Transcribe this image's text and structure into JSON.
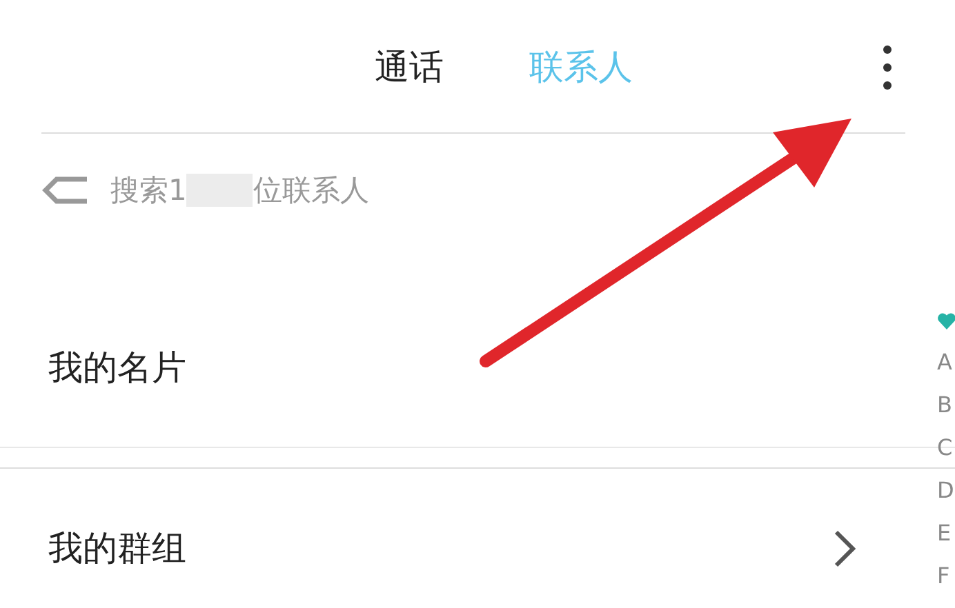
{
  "tabs": [
    {
      "label": "通话",
      "selected": false
    },
    {
      "label": "联系人",
      "selected": true
    }
  ],
  "search": {
    "placeholder_start": "搜索1",
    "placeholder_end": "位联系人"
  },
  "rows": [
    {
      "label": "我的名片",
      "chevron": false
    },
    {
      "label": "我的群组",
      "chevron": true
    }
  ],
  "index": [
    {
      "kind": "heart"
    },
    {
      "kind": "letter",
      "label": "A"
    },
    {
      "kind": "letter",
      "label": "B"
    },
    {
      "kind": "letter",
      "label": "C"
    },
    {
      "kind": "letter",
      "label": "D"
    },
    {
      "kind": "letter",
      "label": "E"
    },
    {
      "kind": "letter",
      "label": "F"
    }
  ]
}
